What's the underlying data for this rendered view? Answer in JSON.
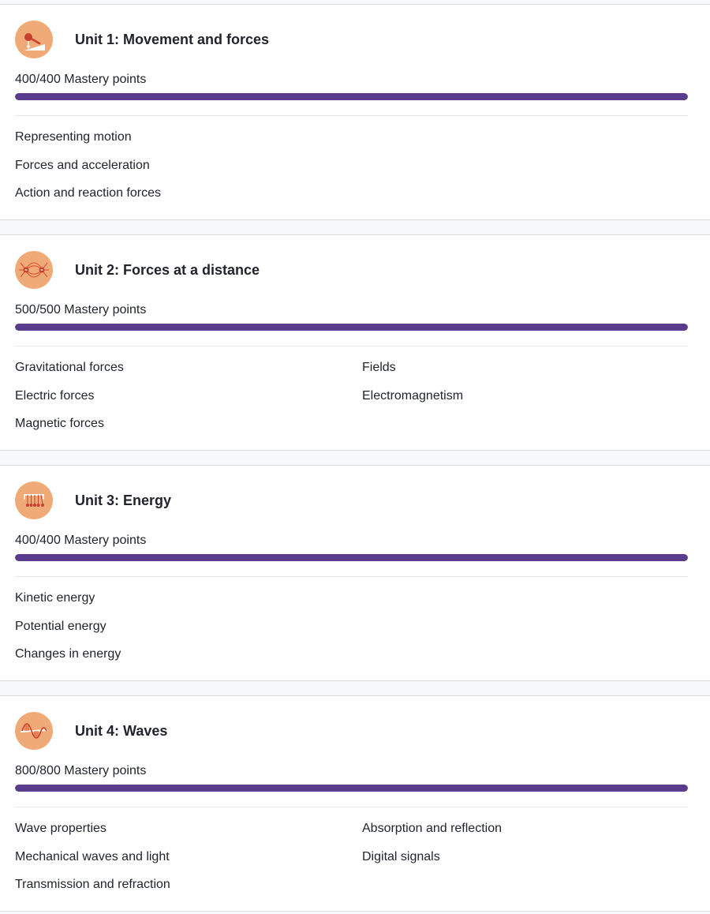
{
  "units": [
    {
      "title": "Unit 1: Movement and forces",
      "icon": "incline-ramp-icon",
      "mastery_text": "400/400 Mastery points",
      "progress": 1.0,
      "lessons": [
        "Representing motion",
        "Forces and acceleration",
        "Action and reaction forces"
      ]
    },
    {
      "title": "Unit 2: Forces at a distance",
      "icon": "field-lines-icon",
      "mastery_text": "500/500 Mastery points",
      "progress": 1.0,
      "lessons": [
        "Gravitational forces",
        "Electric forces",
        "Magnetic forces",
        "Fields",
        "Electromagnetism"
      ]
    },
    {
      "title": "Unit 3: Energy",
      "icon": "newtons-cradle-icon",
      "mastery_text": "400/400 Mastery points",
      "progress": 1.0,
      "lessons": [
        "Kinetic energy",
        "Potential energy",
        "Changes in energy"
      ]
    },
    {
      "title": "Unit 4: Waves",
      "icon": "wave-icon",
      "mastery_text": "800/800 Mastery points",
      "progress": 1.0,
      "lessons": [
        "Wave properties",
        "Mechanical waves and light",
        "Transmission and refraction",
        "Absorption and reflection",
        "Digital signals"
      ]
    }
  ],
  "colors": {
    "progress_fill": "#5a3c8c",
    "icon_background": "#f0aa78",
    "icon_accent": "#c8402e"
  }
}
